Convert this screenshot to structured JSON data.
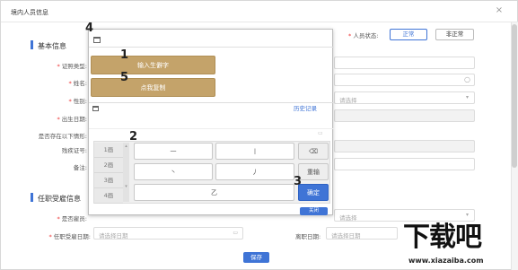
{
  "dialog": {
    "title": "境内人员信息",
    "close": "×"
  },
  "status": {
    "label": "人员状态:",
    "options": [
      "正常",
      "非正常"
    ]
  },
  "sections": {
    "basic": "基本信息",
    "job": "任职受雇信息"
  },
  "fields": {
    "cert_type": "证照类型:",
    "name": "姓名:",
    "gender": "性别:",
    "birth": "出生日期:",
    "special": "是否存在以下情形:",
    "disability_no": "残疾证号:",
    "remark": "备注:",
    "employed": "是否雇员:",
    "hire_date": "任职受雇日期:",
    "hire_date_ph": "请选择日期",
    "leave_date": "离职日期:",
    "leave_date_ph": "请选择日期",
    "select_ph": "请选择",
    "right_select_ph": "请选择",
    "right_select2_ph": "请选择"
  },
  "save": "保存",
  "ime": {
    "handwrite_btn": "输入生僻字",
    "copy_btn": "点我复制",
    "history": "历史记录",
    "side_keys": [
      "1画",
      "2画",
      "3画",
      "4画"
    ],
    "keys": [
      "一",
      "丨",
      "丶",
      "丿",
      "乙"
    ],
    "backspace": "⌫",
    "rewrite": "重输",
    "confirm": "确定",
    "close": "关闭"
  },
  "callouts": [
    "1",
    "2",
    "3",
    "4",
    "5"
  ],
  "watermark": {
    "title": "下载吧",
    "url": "www.xiazaiba.com"
  }
}
